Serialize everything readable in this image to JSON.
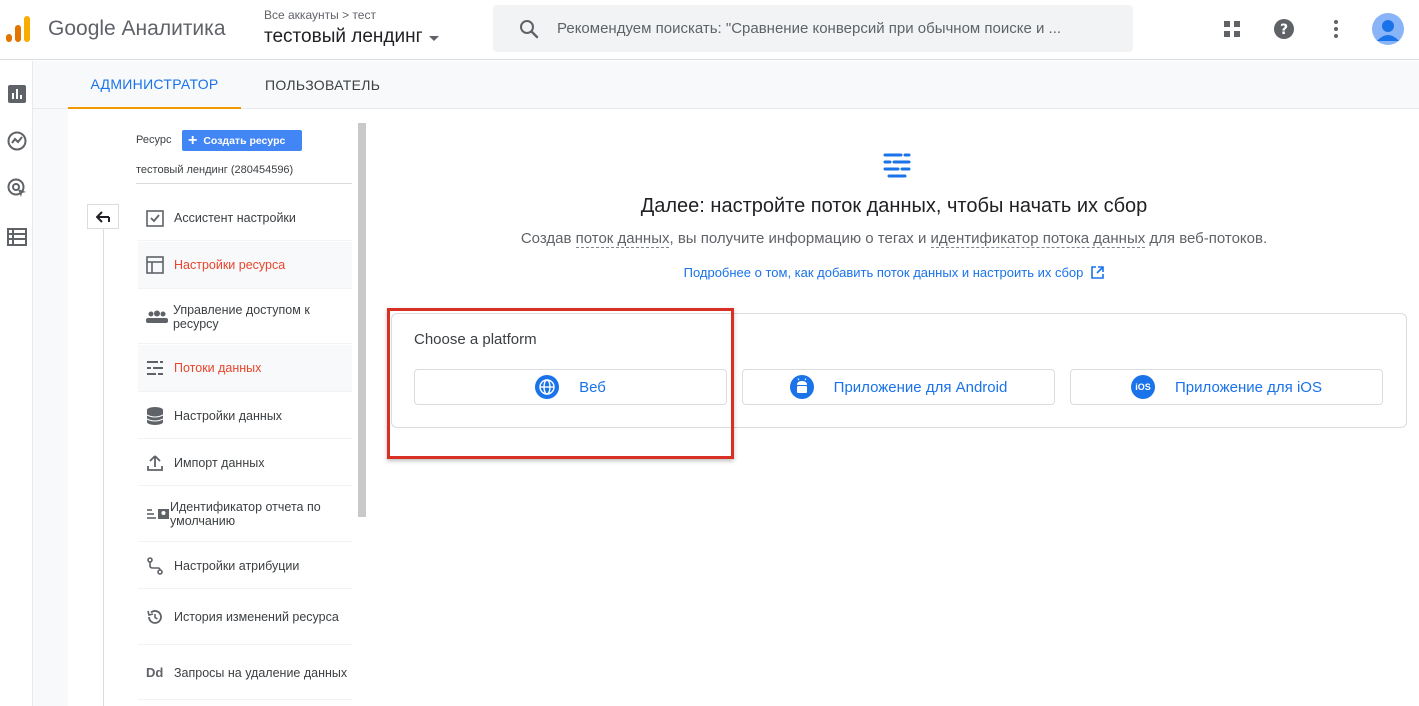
{
  "header": {
    "app_name": "Google Аналитика",
    "account_breadcrumb": "Все аккаунты > тест",
    "property_name": "тестовый лендинг",
    "search_placeholder": "Рекомендуем поискать: \"Сравнение конверсий при обычном поиске и ...",
    "icons": [
      "apps-grid-icon",
      "help-icon",
      "more-vert-icon",
      "account-avatar-icon"
    ]
  },
  "left_nav": {
    "icons": [
      "reports-icon",
      "explore-icon",
      "advertising-icon",
      "configure-icon"
    ]
  },
  "tabs": [
    {
      "label": "АДМИНИСТРАТОР",
      "active": true
    },
    {
      "label": "ПОЛЬЗОВАТЕЛЬ",
      "active": false
    }
  ],
  "resource_panel": {
    "label": "Ресурс",
    "create_button": "Создать ресурс",
    "property": "тестовый лендинг (280454596)",
    "menu": [
      {
        "label": "Ассистент настройки",
        "icon": "checklist-icon",
        "active": false
      },
      {
        "label": "Настройки ресурса",
        "icon": "property-settings-icon",
        "active": true
      },
      {
        "label": "Управление доступом к ресурсу",
        "icon": "people-icon",
        "active": false
      },
      {
        "label": "Потоки данных",
        "icon": "data-streams-icon",
        "active": true
      },
      {
        "label": "Настройки данных",
        "icon": "database-icon",
        "active": false
      },
      {
        "label": "Импорт данных",
        "icon": "upload-icon",
        "active": false
      },
      {
        "label": "Идентификатор отчета по умолчанию",
        "icon": "reporting-id-icon",
        "active": false
      },
      {
        "label": "Настройки атрибуции",
        "icon": "attribution-icon",
        "active": false
      },
      {
        "label": "История изменений ресурса",
        "icon": "history-icon",
        "active": false
      },
      {
        "label": "Запросы на удаление данных",
        "icon": "data-deletion-icon",
        "active": false
      }
    ]
  },
  "main": {
    "headline": "Далее: настройте поток данных, чтобы начать их сбор",
    "sub_prefix": "Создав ",
    "sub_term1": "поток данных",
    "sub_middle": ", вы получите информацию о тегах и ",
    "sub_term2": "идентификатор потока данных",
    "sub_suffix": " для веб-потоков.",
    "help_link": "Подробнее о том, как добавить поток данных и настроить их сбор",
    "platform_title": "Choose a platform",
    "platforms": [
      {
        "label": "Веб",
        "icon": "web-globe-icon"
      },
      {
        "label": "Приложение для Android",
        "icon": "android-icon"
      },
      {
        "label": "Приложение для iOS",
        "icon": "ios-icon",
        "badge": "iOS"
      }
    ]
  },
  "colors": {
    "accent": "#1a73e8",
    "tab_indicator": "#f29900",
    "active_menu": "#e8452c",
    "highlight_box": "#d93025"
  }
}
